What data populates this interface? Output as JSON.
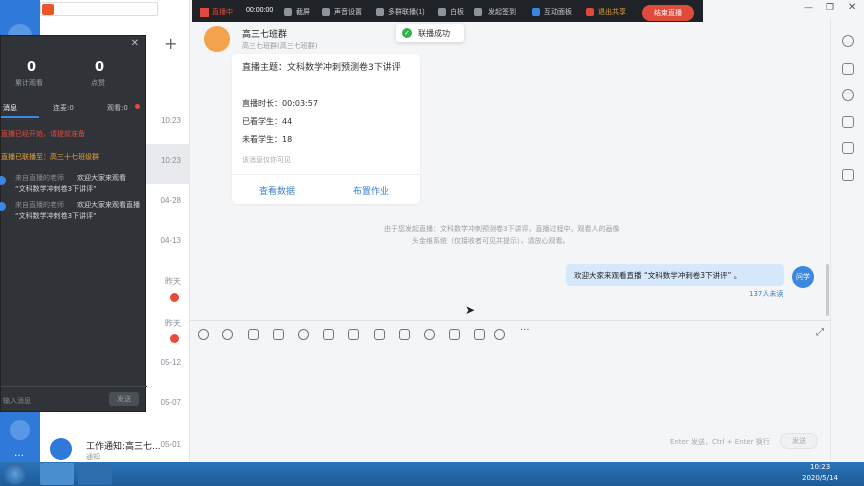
{
  "top_toolbar": {
    "live_label": "直播中",
    "timer": "00:00:00",
    "items": [
      "截屏",
      "声音设置",
      "多群联播(1)",
      "白板",
      "发起签到",
      "互动面板",
      "退出共享"
    ],
    "end_button": "结束直播"
  },
  "toast": {
    "text": "联播成功"
  },
  "chat_header": {
    "group_name": "高三七班群",
    "sub": "高三七班群(高三七班群)"
  },
  "live_card": {
    "title": "直播主题：文科数学冲刺预测卷3下讲评",
    "duration": "直播时长：00:03:57",
    "watched": "已看学生：44",
    "unwatched": "未看学生：18",
    "note": "该消息仅你可见",
    "btn_view": "查看数据",
    "btn_homework": "布置作业"
  },
  "system_notice": {
    "line1": "由于您发起直播：文科数学冲刺预测卷3下讲评，直播过程中，观看人的画像",
    "line2": "头金维系统（仅接收者可见并提示），请放心观看。"
  },
  "outgoing_message": {
    "text": "欢迎大家来观看直播 “文科数学冲刺卷3下讲评” 。",
    "status": "137人未读",
    "avatar_text": "问学"
  },
  "compose": {
    "hint": "Enter 发送，Ctrl + Enter 换行",
    "send": "发送"
  },
  "live_panel": {
    "stat1_value": "0",
    "stat1_label": "累计观看",
    "stat2_value": "0",
    "stat2_label": "点赞",
    "tabs": [
      "消息",
      "连麦:0",
      "观看:0"
    ],
    "red_msg": "直播已经开始，请提前准备",
    "orange_msg": "直播已联播至：高三十七班级群",
    "msg1_head": "来自直播的老师",
    "msg1_line1": "欢迎大家来观看",
    "msg1_line2": "“文科数学冲刺卷3下讲评”",
    "msg2_head": "来自直播的老师",
    "msg2_line1": "欢迎大家来观看直播",
    "msg2_line2": "“文科数学冲刺卷3下讲评”",
    "input_placeholder": "输入消息",
    "send": "发送"
  },
  "conv_list": {
    "times": [
      "10:23",
      "10:23",
      "04-28",
      "04-13",
      "昨天",
      "昨天",
      "05-12",
      "05-07",
      "05-01"
    ],
    "last_item_title": "工作通知:高三七...",
    "last_item_snippet": "通知"
  },
  "taskbar": {
    "time": "10:23",
    "date": "2020/5/14"
  },
  "colors": {
    "accent": "#2f7ad8",
    "end_red": "#e04a3b",
    "dark_panel": "#303338"
  }
}
